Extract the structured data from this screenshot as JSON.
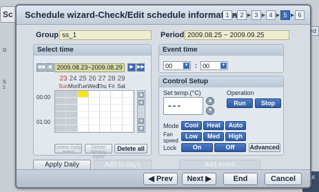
{
  "background": {
    "tab_label": "Sc",
    "right_label": "rd",
    "side_text_1": "G",
    "side_text_2": "S",
    "side_text_3": "1",
    "bottom_label": "out"
  },
  "dialog": {
    "title": "Schedule wizard-Check/Edit schedule information",
    "steps": [
      "1",
      "2",
      "3",
      "4",
      "5",
      "6"
    ],
    "active_step": "5"
  },
  "group": {
    "label": "Group",
    "value": "ss_1"
  },
  "period": {
    "label": "Period",
    "value": "2009.08.25 ~ 2009.09.25"
  },
  "select_time": {
    "header": "Select time",
    "prev_prev_icon": "rewind-icon",
    "date_range": "2009.08.23~2009.08.29",
    "day_numbers": [
      "23",
      "24",
      "25",
      "26",
      "27",
      "28",
      "29"
    ],
    "day_names": [
      "Sun",
      "Mon",
      "Tue",
      "Wed",
      "Thu",
      "Fri",
      "Sat"
    ],
    "time_labels": [
      "00:00",
      "01:00"
    ],
    "delete_daily": "Delete Daily event",
    "delete_weekly": "Delete Weekly event",
    "delete_all": "Delete all"
  },
  "event_time": {
    "header": "Event  time",
    "hour": "00",
    "separator": ":",
    "minute": "00"
  },
  "control_setup": {
    "header": "Control Setup",
    "set_temp_label": "Set temp.(°C)",
    "temp_value": "---",
    "operation_label": "Operation",
    "run": "Run",
    "stop": "Stop",
    "mode_label": "Mode",
    "modes": [
      "Cool",
      "Heat",
      "Auto"
    ],
    "fan_label": "Fan speed",
    "fans": [
      "Low",
      "Med",
      "High"
    ],
    "lock_label": "Lock",
    "lock_on": "On",
    "lock_off": "Off",
    "advanced": "Advanced"
  },
  "actions": {
    "apply_daily": "Apply Daily pattern",
    "add_to_days": "Add to days",
    "add_event": "Add event"
  },
  "footer": {
    "prev": "Prev",
    "next": "Next",
    "end": "End",
    "cancel": "Cancel"
  }
}
